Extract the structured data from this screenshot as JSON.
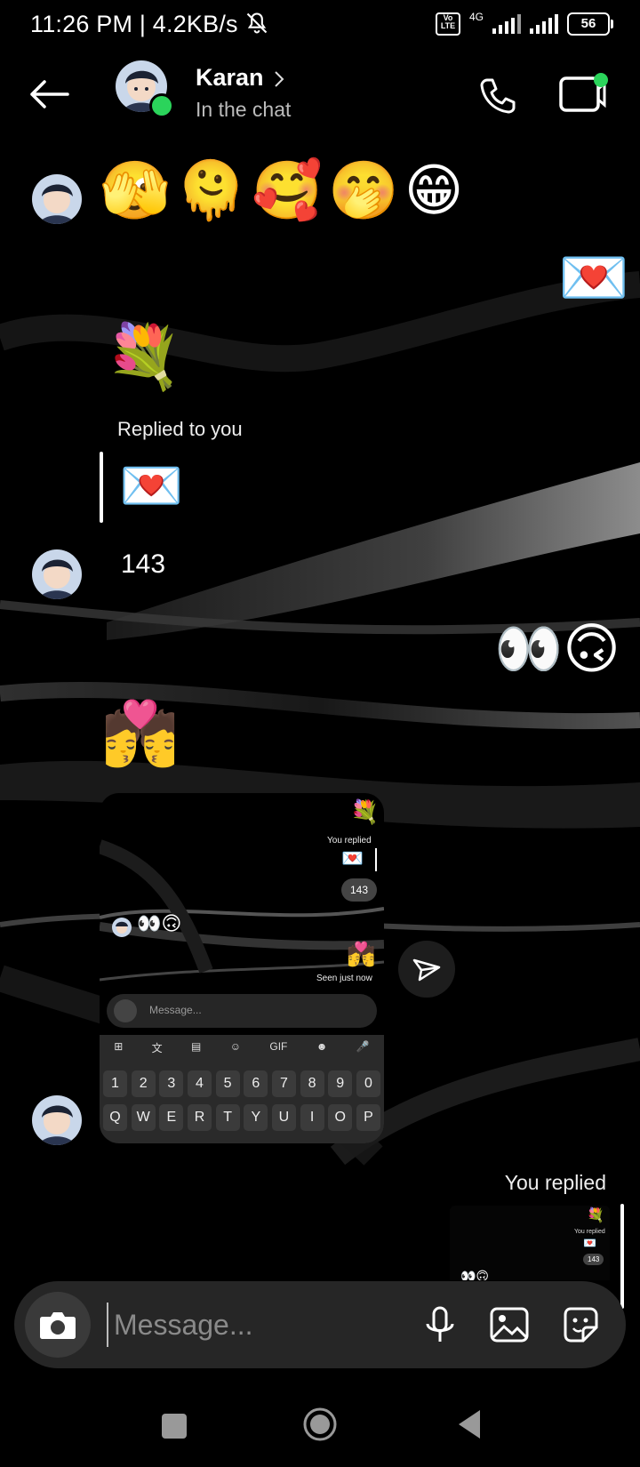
{
  "status_bar": {
    "time": "11:26 PM | 4.2KB/s",
    "volte": "Vo LTE",
    "network": "4G",
    "battery": "56"
  },
  "header": {
    "contact_name": "Karan",
    "contact_status": "In the chat"
  },
  "messages": {
    "emoji_row": [
      "🫣",
      "🫠",
      "🥰",
      "🤭",
      "😁"
    ],
    "sent_letter": "💌",
    "bouquet": "💐",
    "reply_label": "Replied to you",
    "reply_quote": "💌",
    "text_143": "143",
    "sent_eyes": "👀🙃",
    "kiss": "💏"
  },
  "shared_screenshot": {
    "bouquet": "💐",
    "you_replied": "You replied",
    "letter": "💌",
    "pill_143": "143",
    "eyes": "👀🙃",
    "kiss": "💏",
    "seen": "Seen just now",
    "input_placeholder": "Message...",
    "toolbar": [
      "⊞",
      "文",
      "▤",
      "☺",
      "GIF",
      "☻",
      "🎤"
    ],
    "number_row": [
      "1",
      "2",
      "3",
      "4",
      "5",
      "6",
      "7",
      "8",
      "9",
      "0"
    ],
    "letter_row": [
      "Q",
      "W",
      "E",
      "R",
      "T",
      "Y",
      "U",
      "I",
      "O",
      "P"
    ]
  },
  "bottom_reply": {
    "label": "You replied",
    "mini_bouquet": "💐",
    "mini_you_replied": "You replied",
    "mini_letter": "💌",
    "mini_143": "143",
    "mini_eyes": "👀🙃"
  },
  "composer": {
    "placeholder": "Message..."
  },
  "colors": {
    "online": "#2bd45b",
    "composer_bg": "#262626",
    "background": "#000000"
  }
}
